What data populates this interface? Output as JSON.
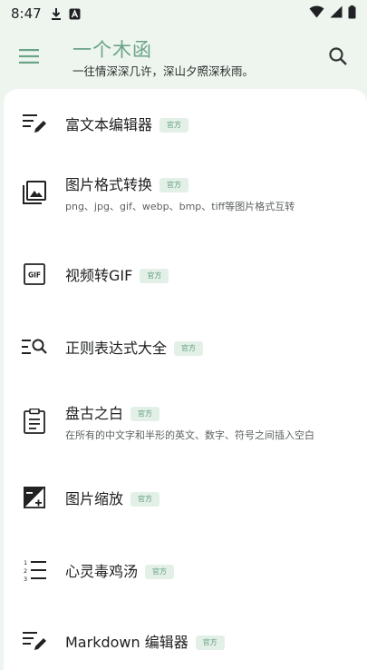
{
  "status_bar": {
    "time": "8:47",
    "icons": [
      "download-icon",
      "app-notification-icon",
      "wifi-icon",
      "signal-icon",
      "battery-icon"
    ]
  },
  "app_bar": {
    "title": "一个木函",
    "subtitle": "一往情深深几许，深山夕照深秋雨。",
    "menu_icon": "menu-icon",
    "search_icon": "search-icon"
  },
  "badge_label": "官方",
  "tools": [
    {
      "name": "富文本编辑器",
      "badge": "官方",
      "description": "",
      "icon": "rich-text-editor-icon"
    },
    {
      "name": "图片格式转换",
      "badge": "官方",
      "description": "png、jpg、gif、webp、bmp、tiff等图片格式互转",
      "icon": "image-format-icon"
    },
    {
      "name": "视频转GIF",
      "badge": "官方",
      "description": "",
      "icon": "gif-icon"
    },
    {
      "name": "正则表达式大全",
      "badge": "官方",
      "description": "",
      "icon": "regex-search-icon"
    },
    {
      "name": "盘古之白",
      "badge": "官方",
      "description": "在所有的中文字和半形的英文、数字、符号之间插入空白",
      "icon": "clipboard-icon"
    },
    {
      "name": "图片缩放",
      "badge": "官方",
      "description": "",
      "icon": "image-resize-icon"
    },
    {
      "name": "心灵毒鸡汤",
      "badge": "官方",
      "description": "",
      "icon": "numbered-list-icon"
    },
    {
      "name": "Markdown 编辑器",
      "badge": "官方",
      "description": "",
      "icon": "markdown-editor-icon"
    }
  ],
  "colors": {
    "accent": "#6aa487",
    "background": "#eef5ef",
    "card": "#ffffff",
    "badge_bg": "#e3f0e7"
  }
}
